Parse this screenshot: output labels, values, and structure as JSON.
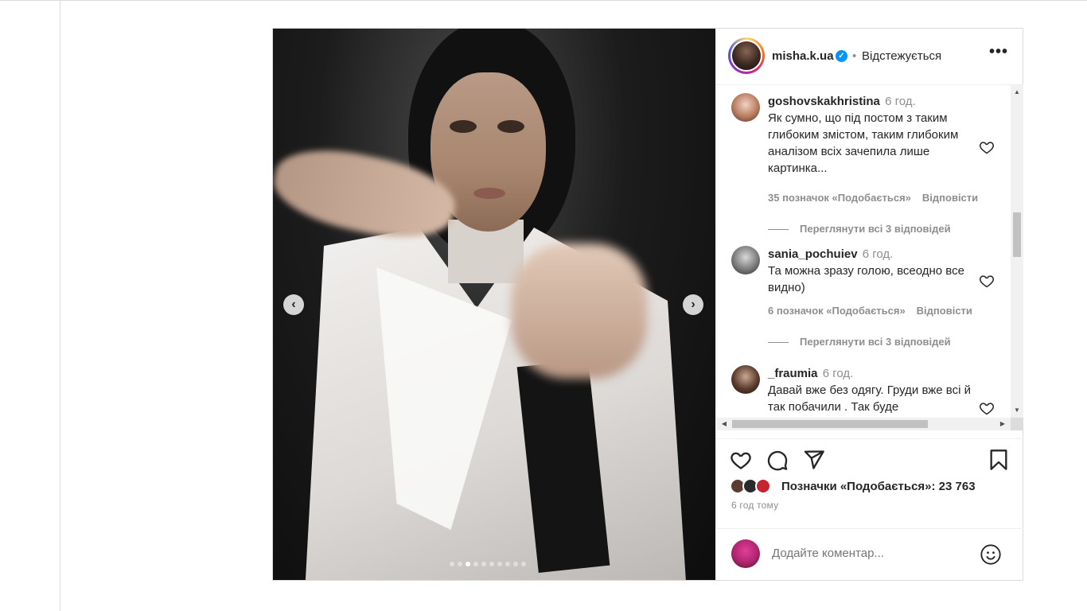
{
  "post": {
    "author": {
      "username": "misha.k.ua",
      "verified_mark": "✓",
      "separator": "•",
      "follow_state": "Відстежується",
      "more_label": "•••"
    },
    "media": {
      "prev_label": "‹",
      "next_label": "›",
      "slide_count": 10,
      "active_slide": 3
    },
    "comments": [
      {
        "username": "goshovskakhristina",
        "time": "6 год.",
        "text": "Як сумно, що під постом з таким глибоким змістом, таким глибоким аналізом всіх зачепила лише картинка...",
        "likes": "35 позначок «Подобається»",
        "reply": "Відповісти",
        "view_replies": "Переглянути всі 3 відповідей"
      },
      {
        "username": "sania_pochuiev",
        "time": "6 год.",
        "text": "Та можна зразу голою, всеодно все видно)",
        "likes": "6 позначок «Подобається»",
        "reply": "Відповісти",
        "view_replies": "Переглянути всі 3 відповідей"
      },
      {
        "username": "_fraumia",
        "time": "6 год.",
        "text": "Давай вже без одягу. Груди вже всі й так побачили . Так буде"
      }
    ],
    "likes_summary": "Позначки «Подобається»: 23 763",
    "posted_ago": "6 год тому",
    "add_comment_placeholder": "Додайте коментар...",
    "scroll": {
      "up": "▲",
      "down": "▼",
      "left": "◀",
      "right": "▶"
    },
    "colors": {
      "verified": "#0095f6",
      "text": "#262626",
      "secondary": "#8e8e8e",
      "border": "#dbdbdb"
    }
  }
}
